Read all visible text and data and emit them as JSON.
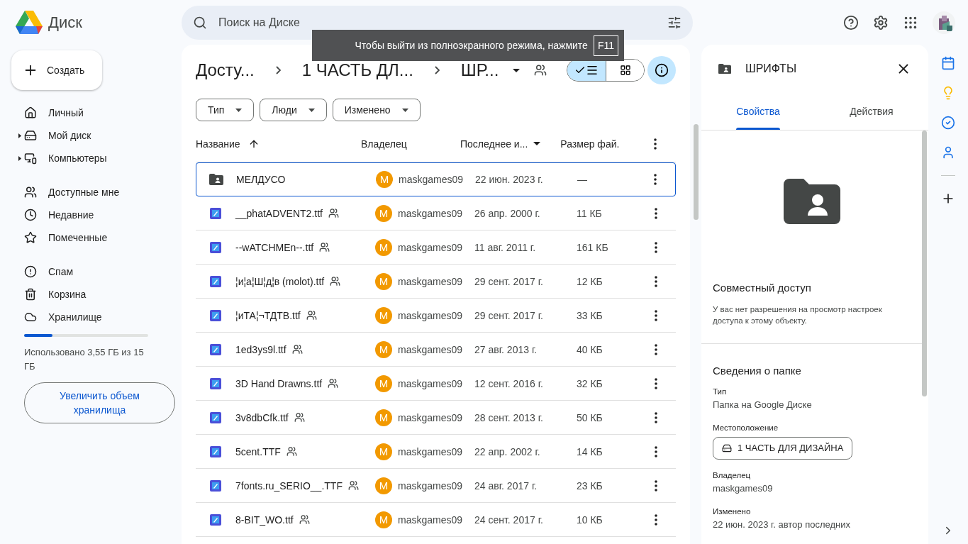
{
  "app": {
    "title": "Диск"
  },
  "search": {
    "placeholder": "Поиск на Диске"
  },
  "toast": {
    "text": "Чтобы выйти из полноэкранного режима, нажмите",
    "key": "F11"
  },
  "create_button": {
    "label": "Создать"
  },
  "sidebar": {
    "groups": [
      {
        "items": [
          {
            "label": "Личный",
            "expandable": false
          },
          {
            "label": "Мой диск",
            "expandable": true
          },
          {
            "label": "Компьютеры",
            "expandable": true
          }
        ]
      },
      {
        "items": [
          {
            "label": "Доступные мне",
            "expandable": false
          },
          {
            "label": "Недавние",
            "expandable": false
          },
          {
            "label": "Помеченные",
            "expandable": false
          }
        ]
      },
      {
        "items": [
          {
            "label": "Спам",
            "expandable": false
          },
          {
            "label": "Корзина",
            "expandable": false
          },
          {
            "label": "Хранилище",
            "expandable": false
          }
        ]
      }
    ]
  },
  "storage": {
    "level": 0.23,
    "text": "Использовано 3,55 ГБ из 15 ГБ",
    "upgrade_button": "Увеличить объем хранилища"
  },
  "breadcrumb": [
    "Досту...",
    "1 ЧАСТЬ ДЛ...",
    "ШР..."
  ],
  "view_toggle": [
    {
      "kind": "list",
      "selected": true
    },
    {
      "kind": "grid",
      "selected": false
    }
  ],
  "info_button": {
    "selected": true
  },
  "filters": [
    "Тип",
    "Люди",
    "Изменено"
  ],
  "table": {
    "columns": [
      "Название",
      "Владелец",
      "Последнее и...",
      "Размер фай."
    ],
    "rows": [
      {
        "kind": "folder",
        "name": "МЕЛДУСО",
        "shared": false,
        "owner": "maskgames09",
        "avatar": "M",
        "modified": "22 июн. 2023 г.",
        "size": "—",
        "selected": true
      },
      {
        "kind": "file",
        "name": "__phatADVENT2.ttf",
        "shared": true,
        "owner": "maskgames09",
        "avatar": "M",
        "modified": "26 апр. 2000 г.",
        "size": "11 КБ",
        "selected": false
      },
      {
        "kind": "file",
        "name": "--wATCHMEn--.ttf",
        "shared": true,
        "owner": "maskgames09",
        "avatar": "M",
        "modified": "11 авг. 2011 г.",
        "size": "161 КБ",
        "selected": false
      },
      {
        "kind": "file",
        "name": "¦и¦а¦Ш¦д¦в (molot).ttf",
        "shared": true,
        "owner": "maskgames09",
        "avatar": "M",
        "modified": "29 сент. 2017 г.",
        "size": "12 КБ",
        "selected": false
      },
      {
        "kind": "file",
        "name": "¦иТА¦¬ТДТВ.ttf",
        "shared": true,
        "owner": "maskgames09",
        "avatar": "M",
        "modified": "29 сент. 2017 г.",
        "size": "33 КБ",
        "selected": false
      },
      {
        "kind": "file",
        "name": "1ed3ys9l.ttf",
        "shared": true,
        "owner": "maskgames09",
        "avatar": "M",
        "modified": "27 авг. 2013 г.",
        "size": "40 КБ",
        "selected": false
      },
      {
        "kind": "file",
        "name": "3D Hand Drawns.ttf",
        "shared": true,
        "owner": "maskgames09",
        "avatar": "M",
        "modified": "12 сент. 2016 г.",
        "size": "32 КБ",
        "selected": false
      },
      {
        "kind": "file",
        "name": "3v8dbCfk.ttf",
        "shared": true,
        "owner": "maskgames09",
        "avatar": "M",
        "modified": "28 сент. 2013 г.",
        "size": "50 КБ",
        "selected": false
      },
      {
        "kind": "file",
        "name": "5cent.TTF",
        "shared": true,
        "owner": "maskgames09",
        "avatar": "M",
        "modified": "22 апр. 2002 г.",
        "size": "14 КБ",
        "selected": false
      },
      {
        "kind": "file",
        "name": "7fonts.ru_SERIO__.TTF",
        "shared": true,
        "owner": "maskgames09",
        "avatar": "M",
        "modified": "24 авг. 2017 г.",
        "size": "23 КБ",
        "selected": false
      },
      {
        "kind": "file",
        "name": "8-BIT_WO.ttf",
        "shared": true,
        "owner": "maskgames09",
        "avatar": "M",
        "modified": "24 сент. 2017 г.",
        "size": "10 КБ",
        "selected": false
      }
    ]
  },
  "details": {
    "title": "ШРИФТЫ",
    "tabs": [
      {
        "label": "Свойства",
        "selected": true
      },
      {
        "label": "Действия",
        "selected": false
      }
    ],
    "sharing": {
      "heading": "Совместный доступ",
      "text": "У вас нет разрешения на просмотр настроек доступа к этому объекту."
    },
    "info": {
      "heading": "Сведения о папке",
      "fields": [
        {
          "kind": "text",
          "label": "Тип",
          "value": "Папка на Google Диске"
        },
        {
          "kind": "location",
          "label": "Местоположение",
          "value": "1 ЧАСТЬ ДЛЯ ДИЗАЙНА"
        },
        {
          "kind": "text",
          "label": "Владелец",
          "value": "maskgames09"
        },
        {
          "kind": "text",
          "label": "Изменено",
          "value": "22 июн. 2023 г. автор последних"
        }
      ]
    }
  }
}
